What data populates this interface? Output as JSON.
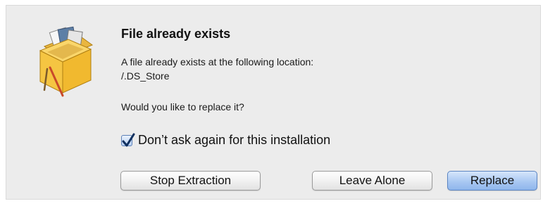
{
  "dialog": {
    "title": "File already exists",
    "message_line1": "A file already exists at the following location:",
    "message_line2": "/.DS_Store",
    "question": "Would you like to replace it?",
    "checkbox": {
      "label": "Don’t ask again for this installation",
      "checked": true
    },
    "buttons": {
      "stop": "Stop Extraction",
      "leave": "Leave Alone",
      "replace": "Replace"
    },
    "icon": "package-installer-icon",
    "colors": {
      "default_button": "#a9c8f2",
      "background": "#ececec"
    }
  }
}
